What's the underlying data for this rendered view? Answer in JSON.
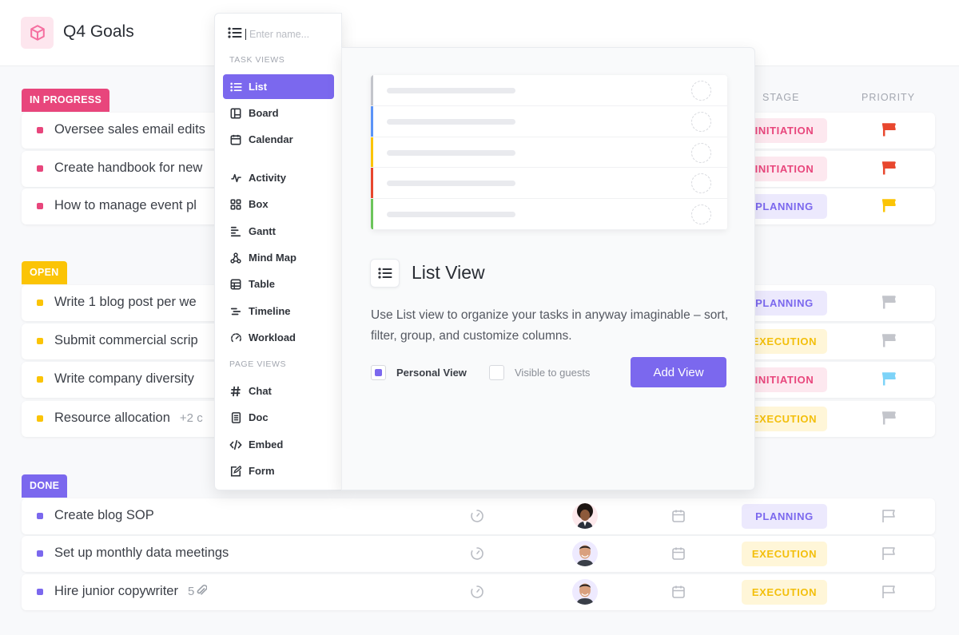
{
  "header": {
    "title": "Q4 Goals",
    "logo_icon": "cube-icon"
  },
  "columns": {
    "stage": "STAGE",
    "priority": "PRIORITY"
  },
  "colors": {
    "accent": "#7b68ee",
    "in_progress": "#e8467c",
    "open": "#fbc406",
    "done": "#7b68ee",
    "flag_urgent": "#e8472e",
    "flag_high": "#fbc406",
    "flag_normal": "#7dd3f8",
    "flag_low": "#c3c5cb"
  },
  "groups": [
    {
      "label": "IN PROGRESS",
      "tasks": [
        {
          "name": "Oversee sales email edits",
          "stage": "INITIATION",
          "priority": "urgent"
        },
        {
          "name": "Create handbook for new",
          "stage": "INITIATION",
          "priority": "urgent"
        },
        {
          "name": "How to manage event pl",
          "stage": "PLANNING",
          "priority": "high"
        }
      ]
    },
    {
      "label": "OPEN",
      "tasks": [
        {
          "name": "Write 1 blog post per we",
          "stage": "PLANNING",
          "priority": "low"
        },
        {
          "name": "Submit commercial scrip",
          "stage": "EXECUTION",
          "priority": "low"
        },
        {
          "name": "Write company diversity",
          "stage": "INITIATION",
          "priority": "normal"
        },
        {
          "name": "Resource allocation",
          "extra": "+2 c",
          "stage": "EXECUTION",
          "priority": "low"
        }
      ]
    },
    {
      "label": "DONE",
      "tasks": [
        {
          "name": "Create blog SOP",
          "stage": "PLANNING",
          "priority": "none",
          "assignee": "avatar-curly-hair"
        },
        {
          "name": "Set up monthly data meetings",
          "stage": "EXECUTION",
          "priority": "none",
          "assignee": "avatar-man-smiling"
        },
        {
          "name": "Hire junior copywriter",
          "extra": "5",
          "extra_icon": "paperclip-icon",
          "stage": "EXECUTION",
          "priority": "none",
          "assignee": "avatar-man-smiling"
        }
      ]
    }
  ],
  "menu": {
    "search_placeholder": "Enter name...",
    "search_value": "",
    "task_views_label": "TASK VIEWS",
    "page_views_label": "PAGE VIEWS",
    "task_views": [
      {
        "label": "List",
        "icon": "list-icon",
        "active": true
      },
      {
        "label": "Board",
        "icon": "board-icon"
      },
      {
        "label": "Calendar",
        "icon": "calendar-icon"
      },
      {
        "label": "Activity",
        "icon": "activity-icon"
      },
      {
        "label": "Box",
        "icon": "box-grid-icon"
      },
      {
        "label": "Gantt",
        "icon": "gantt-icon"
      },
      {
        "label": "Mind Map",
        "icon": "mind-map-icon"
      },
      {
        "label": "Table",
        "icon": "table-icon"
      },
      {
        "label": "Timeline",
        "icon": "timeline-icon"
      },
      {
        "label": "Workload",
        "icon": "workload-gauge-icon"
      }
    ],
    "page_views": [
      {
        "label": "Chat",
        "icon": "hashtag-icon"
      },
      {
        "label": "Doc",
        "icon": "doc-icon"
      },
      {
        "label": "Embed",
        "icon": "code-icon"
      },
      {
        "label": "Form",
        "icon": "form-icon"
      }
    ]
  },
  "preview": {
    "title": "List View",
    "description": "Use List view to organize your tasks in anyway imaginable – sort, filter, group, and customize columns.",
    "mock_row_colors": [
      "#c3c5cb",
      "#5b93f7",
      "#fbc406",
      "#e8472e",
      "#6cc55b"
    ],
    "personal_view_label": "Personal View",
    "personal_view_checked": true,
    "guests_label": "Visible to guests",
    "guests_checked": false,
    "add_button": "Add View"
  }
}
